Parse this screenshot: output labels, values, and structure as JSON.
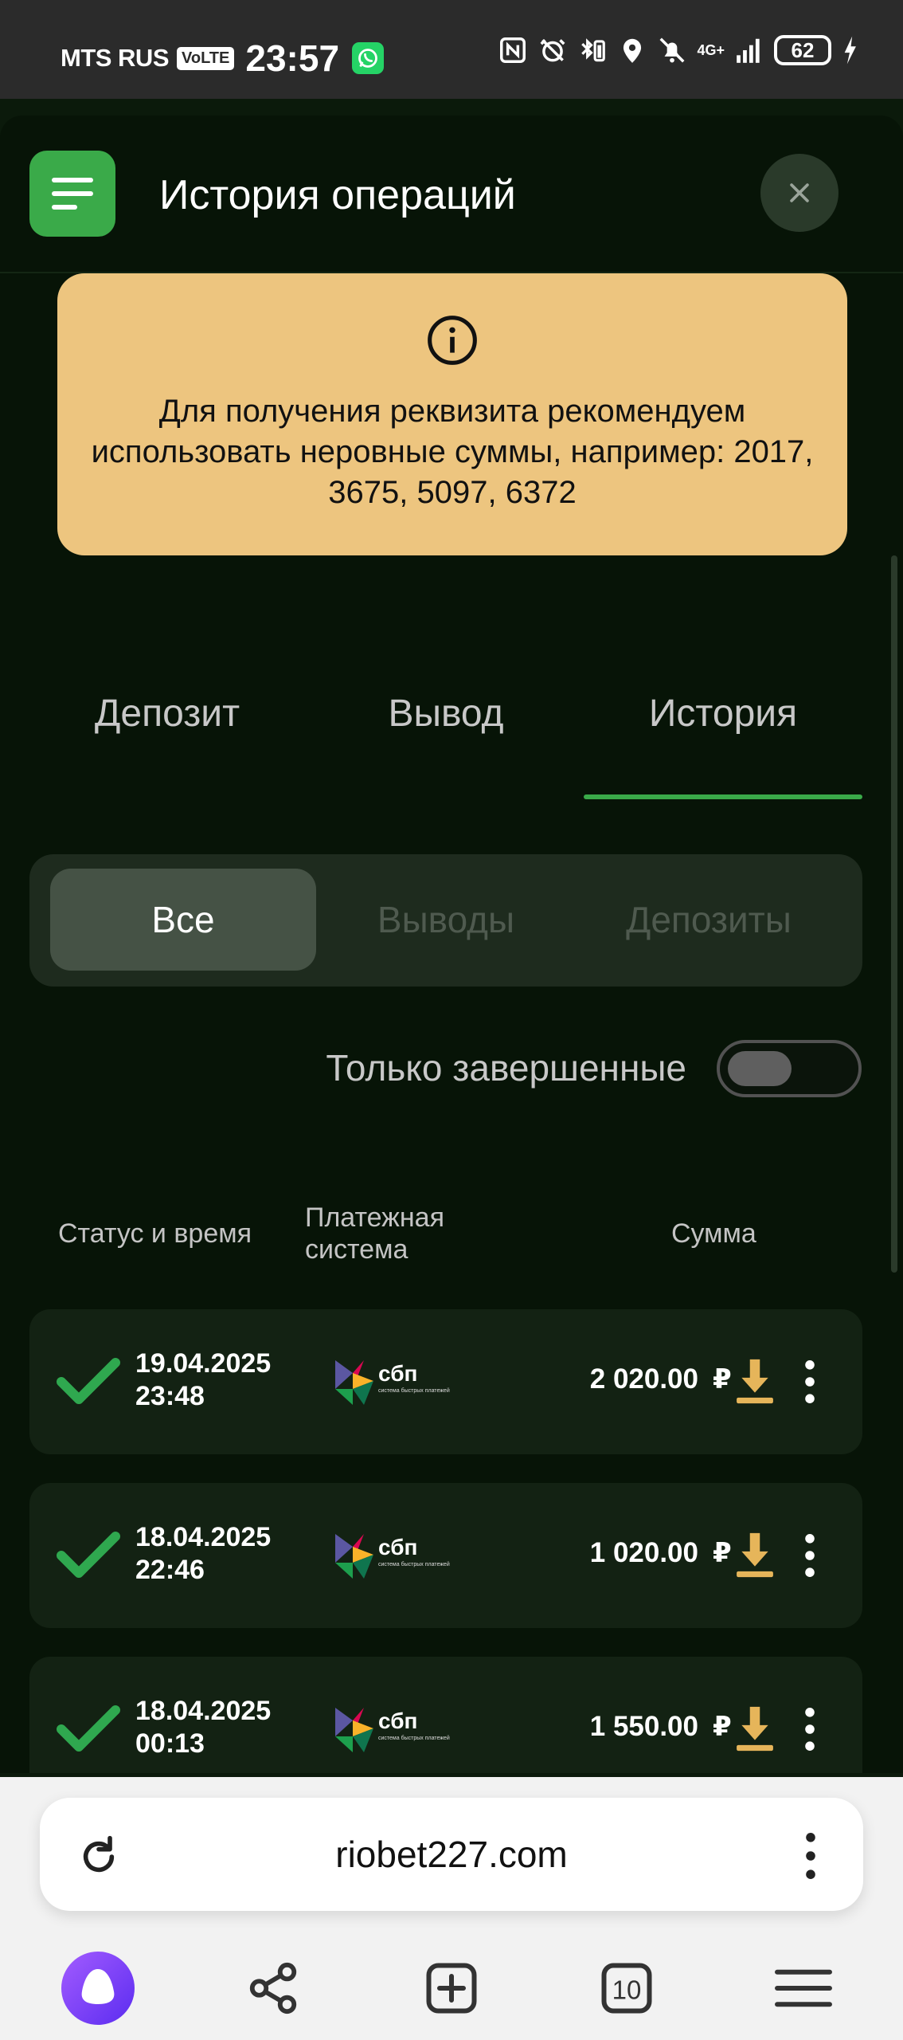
{
  "status_bar": {
    "carrier": "MTS RUS",
    "volte": "VoLTE",
    "time": "23:57",
    "network": "4G+",
    "battery": "62"
  },
  "header": {
    "title": "История операций"
  },
  "notice": {
    "text": "Для получения реквизита рекомендуем использовать неровные суммы, например: 2017, 3675, 5097, 6372"
  },
  "tabs": [
    {
      "label": "Депозит",
      "active": false
    },
    {
      "label": "Вывод",
      "active": false
    },
    {
      "label": "История",
      "active": true
    }
  ],
  "filter": {
    "options": [
      {
        "label": "Все",
        "active": true
      },
      {
        "label": "Выводы",
        "active": false
      },
      {
        "label": "Депозиты",
        "active": false
      }
    ]
  },
  "toggle": {
    "label": "Только завершенные",
    "on": false
  },
  "table": {
    "headers": {
      "status_time": "Статус и время",
      "payment_system_line1": "Платежная",
      "payment_system_line2": "система",
      "amount": "Сумма"
    },
    "rows": [
      {
        "date": "19.04.2025",
        "time": "23:48",
        "system": "сбп",
        "system_sub": "система быстрых платежей",
        "amount": "2 020.00",
        "currency": "₽"
      },
      {
        "date": "18.04.2025",
        "time": "22:46",
        "system": "сбп",
        "system_sub": "система быстрых платежей",
        "amount": "1 020.00",
        "currency": "₽"
      },
      {
        "date": "18.04.2025",
        "time": "00:13",
        "system": "сбп",
        "system_sub": "система быстрых платежей",
        "amount": "1 550.00",
        "currency": "₽"
      }
    ]
  },
  "browser": {
    "url": "riobet227.com",
    "tabs_count": "10"
  },
  "colors": {
    "accent_green": "#3aaa49",
    "notice_bg": "#edc57f",
    "panel_bg": "#071407",
    "row_bg": "#132213",
    "download_gold": "#e6b55a"
  }
}
